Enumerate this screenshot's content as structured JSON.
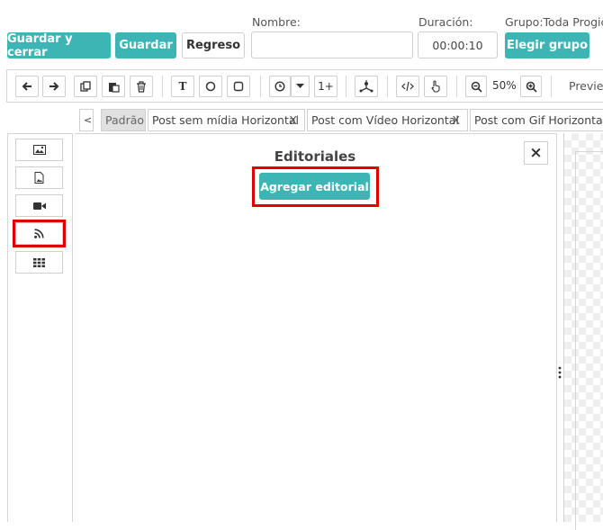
{
  "header": {
    "save_close_label": "Guardar y cerrar",
    "save_label": "Guardar",
    "back_label": "Regreso",
    "name_label": "Nombre:",
    "name_value": "",
    "duration_label": "Duración:",
    "duration_value": "00:00:10",
    "group_label": "Grupo:Toda Progic",
    "choose_group_label": "Elegir grupo"
  },
  "toolbar": {
    "text_tool": "T",
    "counter_label": "1+",
    "zoom_value": "50%",
    "preview_label": "Preview"
  },
  "tabs": {
    "collapse_label": "<",
    "items": [
      {
        "label": "Padrão"
      },
      {
        "label": "Post sem mídia Horizontal",
        "close": "X"
      },
      {
        "label": "Post com Vídeo Horizontal",
        "close": "X"
      },
      {
        "label": "Post com Gif Horizontal"
      }
    ]
  },
  "panel": {
    "title": "Editoriales",
    "add_button": "Agregar editorial",
    "close_symbol": "×"
  },
  "colors": {
    "accent": "#3db5b5",
    "highlight": "#e00000"
  }
}
